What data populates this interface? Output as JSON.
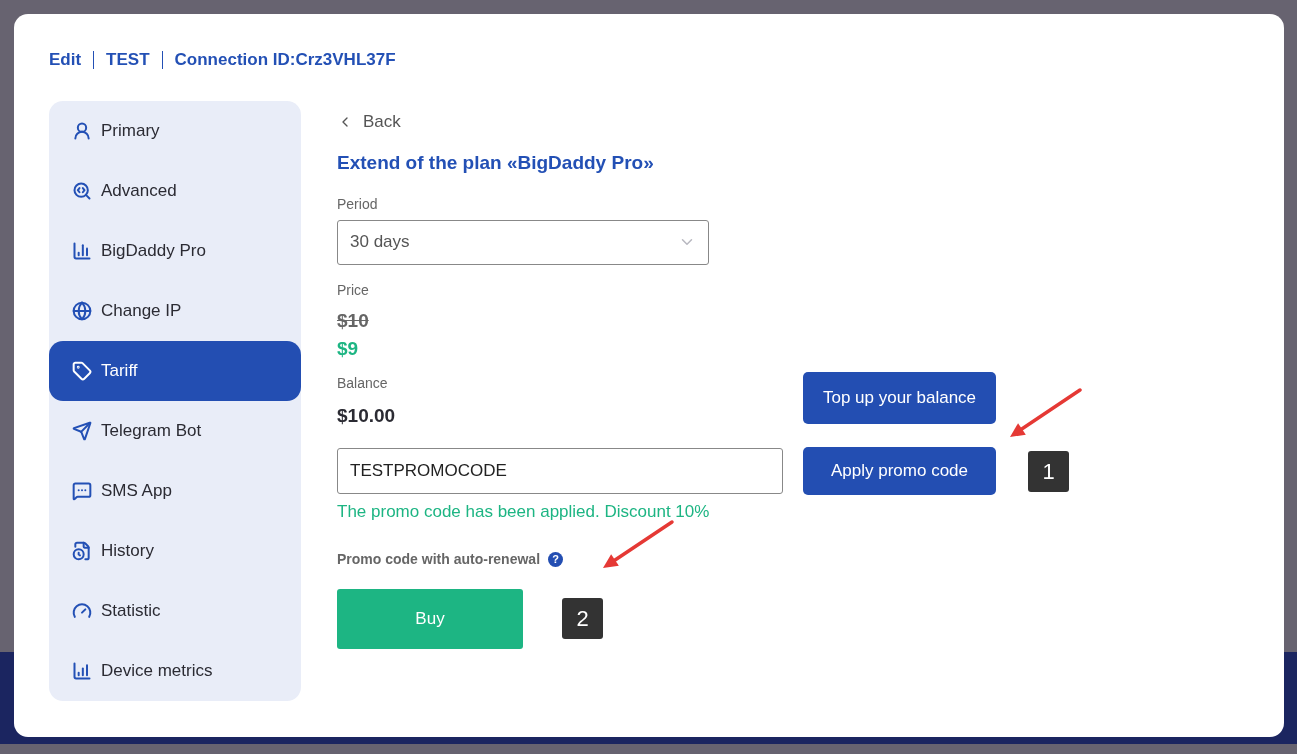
{
  "header": [
    "Edit",
    "TEST",
    "Connection ID:Crz3VHL37F"
  ],
  "sidebar": {
    "items": [
      {
        "label": "Primary",
        "selected": false
      },
      {
        "label": "Advanced",
        "selected": false
      },
      {
        "label": "BigDaddy Pro",
        "selected": false
      },
      {
        "label": "Change IP",
        "selected": false
      },
      {
        "label": "Tariff",
        "selected": true
      },
      {
        "label": "Telegram Bot",
        "selected": false
      },
      {
        "label": "SMS App",
        "selected": false
      },
      {
        "label": "History",
        "selected": false
      },
      {
        "label": "Statistic",
        "selected": false
      },
      {
        "label": "Device metrics",
        "selected": false
      }
    ]
  },
  "back": "Back",
  "title": "Extend of the plan «BigDaddy Pro»",
  "period": {
    "label": "Period",
    "value": "30 days"
  },
  "price": {
    "label": "Price",
    "old": "$10",
    "new": "$9"
  },
  "balance": {
    "label": "Balance",
    "value": "$10.00"
  },
  "top_up_button": "Top up your balance",
  "promo": {
    "value": "TESTPROMOCODE",
    "button": "Apply promo code",
    "message": "The promo code has been applied. Discount 10%"
  },
  "auto_renewal": {
    "label": "Promo code with auto-renewal",
    "help": "?"
  },
  "buy_button": "Buy",
  "annotations": [
    "1",
    "2"
  ]
}
